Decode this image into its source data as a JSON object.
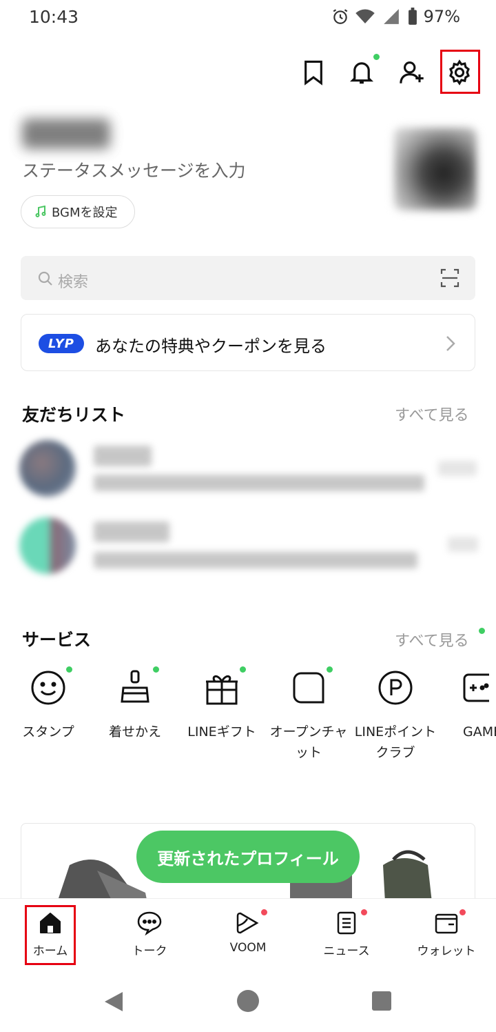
{
  "status_bar": {
    "time": "10:43",
    "battery": "97%"
  },
  "header_icons": [
    "bookmark-icon",
    "bell-icon",
    "add-friend-icon",
    "gear-icon"
  ],
  "profile": {
    "status_message": "ステータスメッセージを入力",
    "bgm_label": "BGMを設定"
  },
  "search": {
    "placeholder": "検索"
  },
  "banner": {
    "badge": "LYP",
    "text": "あなたの特典やクーポンを見る"
  },
  "friends": {
    "title": "友だちリスト",
    "see_all": "すべて見る"
  },
  "services": {
    "title": "サービス",
    "see_all": "すべて見る",
    "items": [
      {
        "label": "スタンプ",
        "icon": "smile-icon"
      },
      {
        "label": "着せかえ",
        "icon": "brush-icon"
      },
      {
        "label": "LINEギフト",
        "icon": "gift-icon"
      },
      {
        "label": "オープンチャット",
        "icon": "open-chat-icon"
      },
      {
        "label": "LINEポイントクラブ",
        "icon": "points-icon"
      },
      {
        "label": "GAME",
        "icon": "gamepad-icon"
      }
    ]
  },
  "updated_profile": {
    "label": "更新されたプロフィール"
  },
  "bottom_nav": [
    {
      "label": "ホーム",
      "icon": "home-icon"
    },
    {
      "label": "トーク",
      "icon": "chat-icon"
    },
    {
      "label": "VOOM",
      "icon": "voom-icon"
    },
    {
      "label": "ニュース",
      "icon": "news-icon"
    },
    {
      "label": "ウォレット",
      "icon": "wallet-icon"
    }
  ],
  "colors": {
    "accent_green": "#4cc764",
    "badge_red": "#f24a5b",
    "highlight": "#e60012",
    "lyp_blue": "#1d4ee3"
  }
}
